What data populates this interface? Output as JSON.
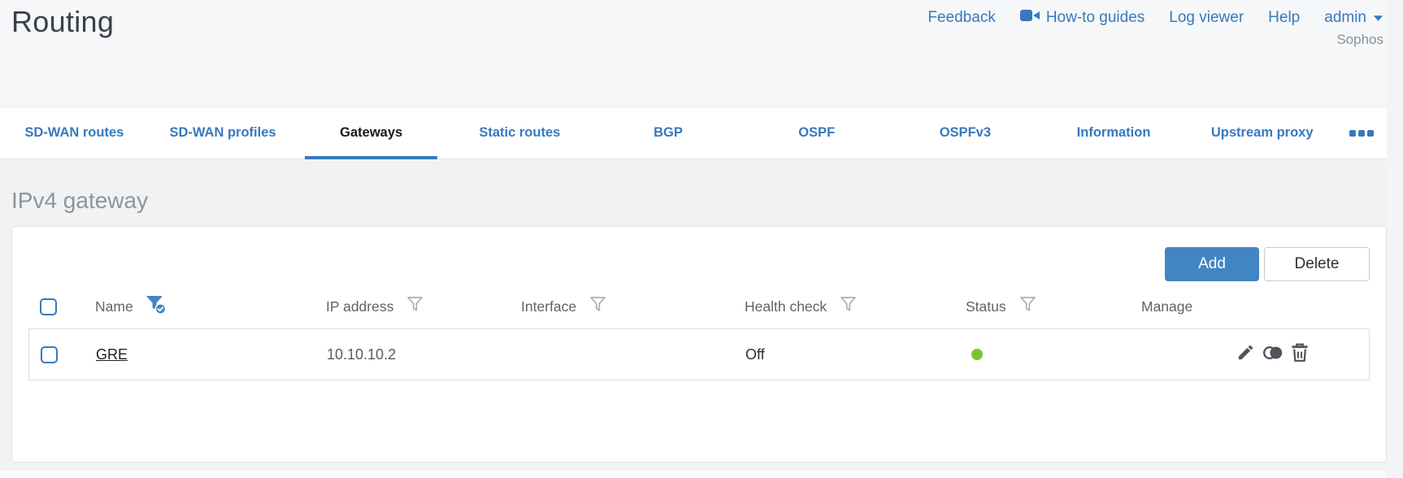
{
  "page": {
    "title": "Routing"
  },
  "header": {
    "links": [
      {
        "label": "Feedback"
      },
      {
        "label": "How-to guides"
      },
      {
        "label": "Log viewer"
      },
      {
        "label": "Help"
      }
    ],
    "user_menu": {
      "label": "admin"
    },
    "brand": "Sophos"
  },
  "tabs": {
    "items": [
      {
        "label": "SD-WAN routes",
        "active": false
      },
      {
        "label": "SD-WAN profiles",
        "active": false
      },
      {
        "label": "Gateways",
        "active": true
      },
      {
        "label": "Static routes",
        "active": false
      },
      {
        "label": "BGP",
        "active": false
      },
      {
        "label": "OSPF",
        "active": false
      },
      {
        "label": "OSPFv3",
        "active": false
      },
      {
        "label": "Information",
        "active": false
      },
      {
        "label": "Upstream proxy",
        "active": false
      }
    ]
  },
  "section": {
    "title": "IPv4 gateway"
  },
  "toolbar": {
    "add_label": "Add",
    "delete_label": "Delete"
  },
  "table": {
    "columns": [
      {
        "label": "Name",
        "filter": "active"
      },
      {
        "label": "IP address",
        "filter": "inactive"
      },
      {
        "label": "Interface",
        "filter": "inactive"
      },
      {
        "label": "Health check",
        "filter": "inactive"
      },
      {
        "label": "Status",
        "filter": "inactive"
      },
      {
        "label": "Manage",
        "filter": "none"
      }
    ],
    "rows": [
      {
        "name": "GRE",
        "ip_address": "10.10.10.2",
        "interface": "",
        "health_check": "Off",
        "status": "up",
        "actions": [
          "edit",
          "clone",
          "delete"
        ]
      }
    ]
  },
  "icons": {
    "howto_link": "video-camera-icon",
    "user_menu": "chevron-down-icon",
    "tabs_overflow": "ellipsis-icon",
    "name_column": "filter-funnel-checked-icon",
    "other_columns": "filter-funnel-icon",
    "edit": "pencil-icon",
    "clone": "clone-icon",
    "delete": "trash-icon",
    "status": "status-dot"
  },
  "colors": {
    "accent": "#3779bd",
    "add_button": "#4285c5",
    "status_up": "#7bc332"
  }
}
